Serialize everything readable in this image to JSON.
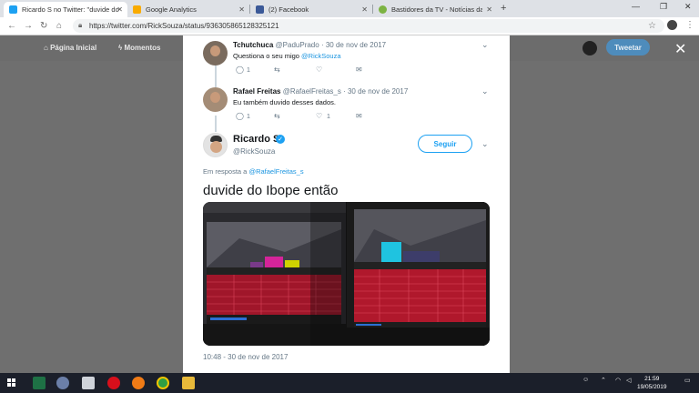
{
  "browser": {
    "tabs": [
      {
        "title": "Ricardo S no Twitter: \"duvide do",
        "favicon_color": "#1da1f2"
      },
      {
        "title": "Google Analytics",
        "favicon_color": "#f9ab00"
      },
      {
        "title": "(2) Facebook",
        "favicon_color": "#3b5998"
      },
      {
        "title": "Bastidores da TV - Notícias da TV",
        "favicon_color": "#7cb342"
      }
    ],
    "url": "https://twitter.com/RickSouza/status/936305865128325121"
  },
  "twitter_nav": {
    "home": "Página Inicial",
    "moments": "Momentos",
    "tweet_button": "Tweetar"
  },
  "replies": [
    {
      "name": "Tchutchuca",
      "handle": "@PaduPrado",
      "date": "· 30 de nov de 2017",
      "text": "Questiona o seu migo ",
      "mention": "@RickSouza",
      "reply_count": "1",
      "like_count": ""
    },
    {
      "name": "Rafael Freitas",
      "handle": "@RafaelFreitas_s",
      "date": "· 30 de nov de 2017",
      "text": "Eu também duvido desses dados.",
      "mention": "",
      "reply_count": "1",
      "like_count": "1"
    }
  ],
  "main_tweet": {
    "name": "Ricardo S",
    "handle": "@RickSouza",
    "follow_label": "Seguir",
    "in_reply_prefix": "Em resposta a ",
    "in_reply_handle": "@RafaelFreitas_s",
    "text": "duvide do Ibope então",
    "timestamp": "10:48 - 30 de nov de 2017"
  },
  "taskbar": {
    "time": "21:59",
    "date": "19/05/2019"
  }
}
